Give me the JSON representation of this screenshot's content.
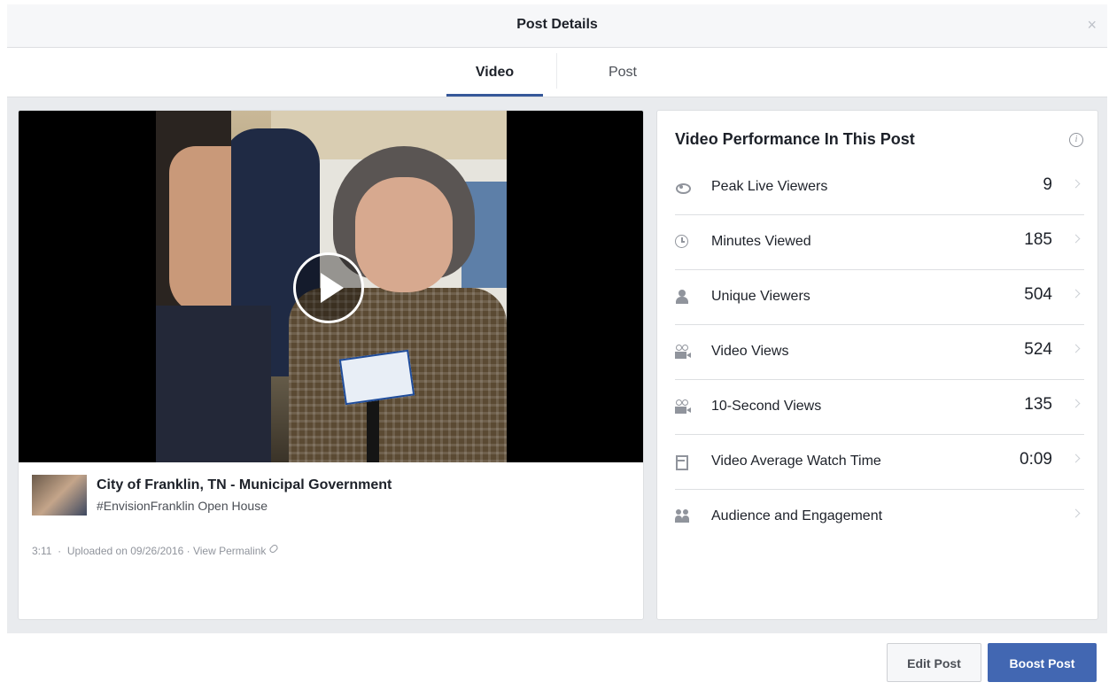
{
  "modal": {
    "title": "Post Details",
    "close_label": "×"
  },
  "tabs": [
    {
      "label": "Video",
      "active": true
    },
    {
      "label": "Post",
      "active": false
    }
  ],
  "video": {
    "play_icon": "play-icon",
    "page_name": "City of Franklin, TN - Municipal Government",
    "description": "#EnvisionFranklin Open House",
    "duration": "3:11",
    "separator": "·",
    "uploaded": "Uploaded on 09/26/2016",
    "permalink_label": "View Permalink"
  },
  "performance": {
    "title": "Video Performance In This Post",
    "info_icon": "i",
    "metrics": [
      {
        "icon": "eye-icon",
        "label": "Peak Live Viewers",
        "value": "9"
      },
      {
        "icon": "clock-icon",
        "label": "Minutes Viewed",
        "value": "185"
      },
      {
        "icon": "person-icon",
        "label": "Unique Viewers",
        "value": "504"
      },
      {
        "icon": "video-camera-icon",
        "label": "Video Views",
        "value": "524"
      },
      {
        "icon": "video-camera-icon",
        "label": "10-Second Views",
        "value": "135"
      },
      {
        "icon": "film-icon",
        "label": "Video Average Watch Time",
        "value": "0:09"
      },
      {
        "icon": "people-icon",
        "label": "Audience and Engagement",
        "value": ""
      }
    ]
  },
  "footer": {
    "edit_label": "Edit Post",
    "boost_label": "Boost Post"
  },
  "colors": {
    "accent": "#4267b2",
    "tab_underline": "#365899",
    "body_bg": "#e9ebee"
  }
}
